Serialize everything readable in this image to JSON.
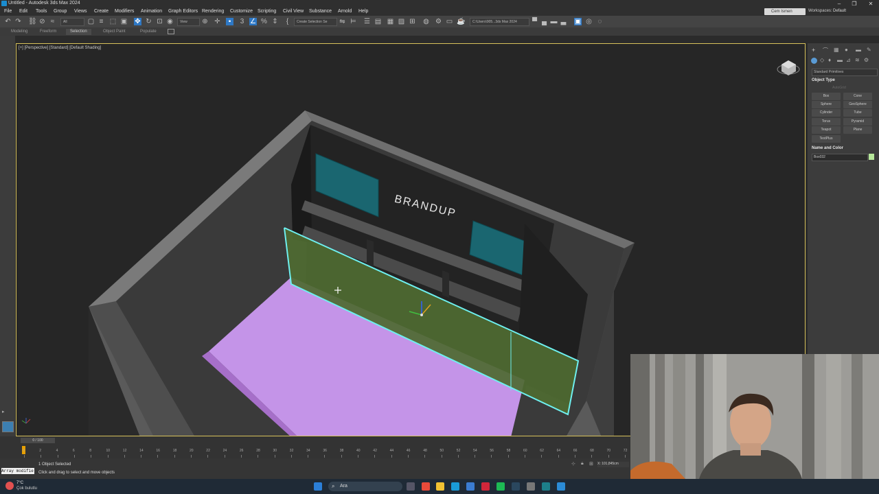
{
  "window": {
    "title": "Untitled - Autodesk 3ds Max 2024",
    "minimize": "–",
    "maximize": "❐",
    "close": "✕"
  },
  "menubar": {
    "items": [
      "File",
      "Edit",
      "Tools",
      "Group",
      "Views",
      "Create",
      "Modifiers",
      "Animation",
      "Graph Editors",
      "Rendering",
      "Customize",
      "Scripting",
      "Civil View",
      "Substance",
      "Arnold",
      "Help"
    ],
    "user": "Cem Ismen",
    "workspaces_label": "Workspaces:",
    "workspace": "Default"
  },
  "toolbar": {
    "filter": "All",
    "view": "View",
    "selection_set": "Create Selection Se",
    "project_path": "C:\\Users\\905...3ds Max 2024"
  },
  "ribbon": {
    "tabs": [
      "Modeling",
      "Freeform",
      "Selection",
      "Object Paint",
      "Populate"
    ],
    "active": "Selection"
  },
  "viewport": {
    "label": "[+] [Perspective] [Standard] [Default Shading]",
    "sign_text": "BRANDUP",
    "colors": {
      "floor": "#c494e8",
      "selected_panel": "#4f6b32",
      "screen": "#1a6670",
      "wall": "#686868",
      "back_wall": "#242424",
      "selection_outline": "#6ef0f0"
    }
  },
  "command_panel": {
    "category": "Standard Primitives",
    "object_type_header": "Object Type",
    "autogrid": "AutoGrid",
    "buttons": [
      "Box",
      "Cone",
      "Sphere",
      "GeoSphere",
      "Cylinder",
      "Tube",
      "Torus",
      "Pyramid",
      "Teapot",
      "Plane",
      "TextPlus"
    ],
    "name_color_header": "Name and Color",
    "object_name": "Box032",
    "object_color": "#b6e79a"
  },
  "timeline": {
    "frame_counter": "0 / 100",
    "ticks": [
      "0",
      "2",
      "4",
      "6",
      "8",
      "10",
      "12",
      "14",
      "16",
      "18",
      "20",
      "22",
      "24",
      "26",
      "28",
      "30",
      "32",
      "34",
      "36",
      "38",
      "40",
      "42",
      "44",
      "46",
      "48",
      "50",
      "52",
      "54",
      "56",
      "58",
      "60",
      "62",
      "64",
      "66",
      "68",
      "70",
      "72"
    ]
  },
  "status": {
    "maxscript": "Array modifie",
    "selected": "1 Object Selected",
    "hint": "Click and drag to select and move objects",
    "coord": "X: 101,845cm"
  },
  "taskbar": {
    "weather_temp": "7°C",
    "weather_desc": "Çok bulutlu",
    "search": "Ara"
  }
}
